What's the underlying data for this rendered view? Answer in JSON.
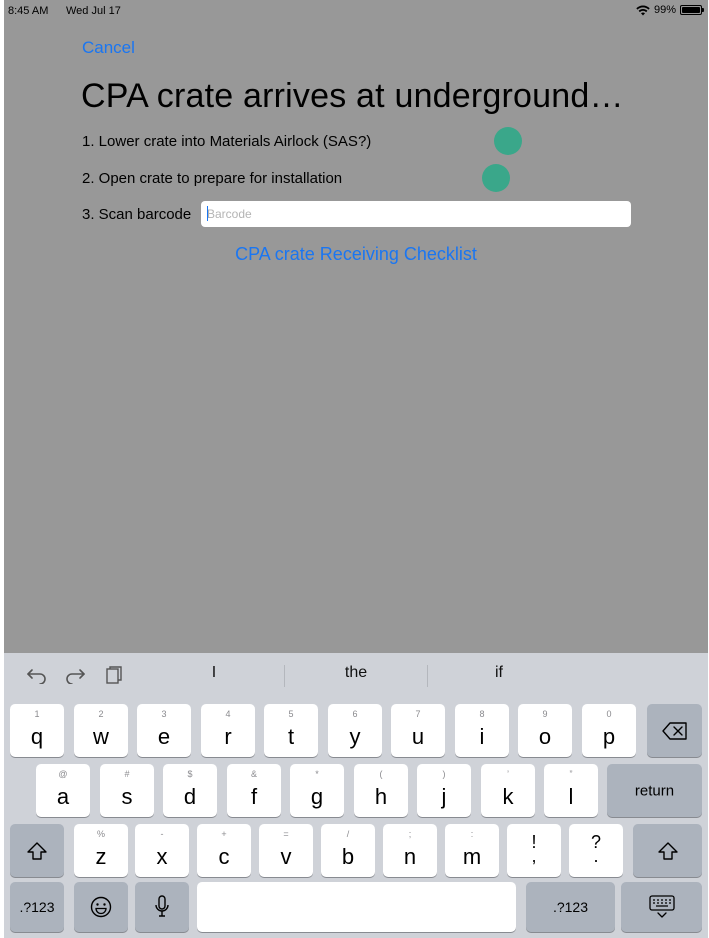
{
  "status_bar": {
    "time": "8:45 AM",
    "date": "Wed Jul 17",
    "battery": "99%"
  },
  "nav": {
    "cancel": "Cancel"
  },
  "title": "CPA crate arrives at underground…",
  "steps": [
    {
      "label": "1.  Lower crate into Materials Airlock (SAS?)"
    },
    {
      "label": "2.  Open crate to prepare for installation"
    },
    {
      "label": "3.  Scan barcode"
    }
  ],
  "barcode": {
    "placeholder": "Barcode",
    "value": ""
  },
  "checklist_link": "CPA crate Receiving Checklist",
  "colors": {
    "accent": "#1a76f2",
    "status_dot": "#3aa78a",
    "backdrop": "#989898",
    "keyboard": "#cfd2d8"
  },
  "keyboard": {
    "toolbar_icons": [
      "undo-icon",
      "redo-icon",
      "paste-icon"
    ],
    "suggestions": [
      "I",
      "the",
      "if"
    ],
    "row1": [
      {
        "main": "q",
        "sub": "1"
      },
      {
        "main": "w",
        "sub": "2"
      },
      {
        "main": "e",
        "sub": "3"
      },
      {
        "main": "r",
        "sub": "4"
      },
      {
        "main": "t",
        "sub": "5"
      },
      {
        "main": "y",
        "sub": "6"
      },
      {
        "main": "u",
        "sub": "7"
      },
      {
        "main": "i",
        "sub": "8"
      },
      {
        "main": "o",
        "sub": "9"
      },
      {
        "main": "p",
        "sub": "0"
      }
    ],
    "row2": [
      {
        "main": "a",
        "sub": "@"
      },
      {
        "main": "s",
        "sub": "#"
      },
      {
        "main": "d",
        "sub": "$"
      },
      {
        "main": "f",
        "sub": "&"
      },
      {
        "main": "g",
        "sub": "*"
      },
      {
        "main": "h",
        "sub": "("
      },
      {
        "main": "j",
        "sub": ")"
      },
      {
        "main": "k",
        "sub": "’"
      },
      {
        "main": "l",
        "sub": "”"
      }
    ],
    "row3": [
      {
        "main": "z",
        "sub": "%"
      },
      {
        "main": "x",
        "sub": "-"
      },
      {
        "main": "c",
        "sub": "+"
      },
      {
        "main": "v",
        "sub": "="
      },
      {
        "main": "b",
        "sub": "/"
      },
      {
        "main": "n",
        "sub": ";"
      },
      {
        "main": "m",
        "sub": ":"
      },
      {
        "main": "!",
        "sub": ""
      },
      {
        "main": "?",
        "sub": ""
      }
    ],
    "punct_sub": [
      ",",
      "."
    ],
    "return_label": "return",
    "numbers_label": ".?123",
    "icons": {
      "delete": "delete-icon",
      "shift": "shift-icon",
      "emoji": "emoji-icon",
      "mic": "microphone-icon",
      "dismiss": "keyboard-dismiss-icon"
    }
  }
}
